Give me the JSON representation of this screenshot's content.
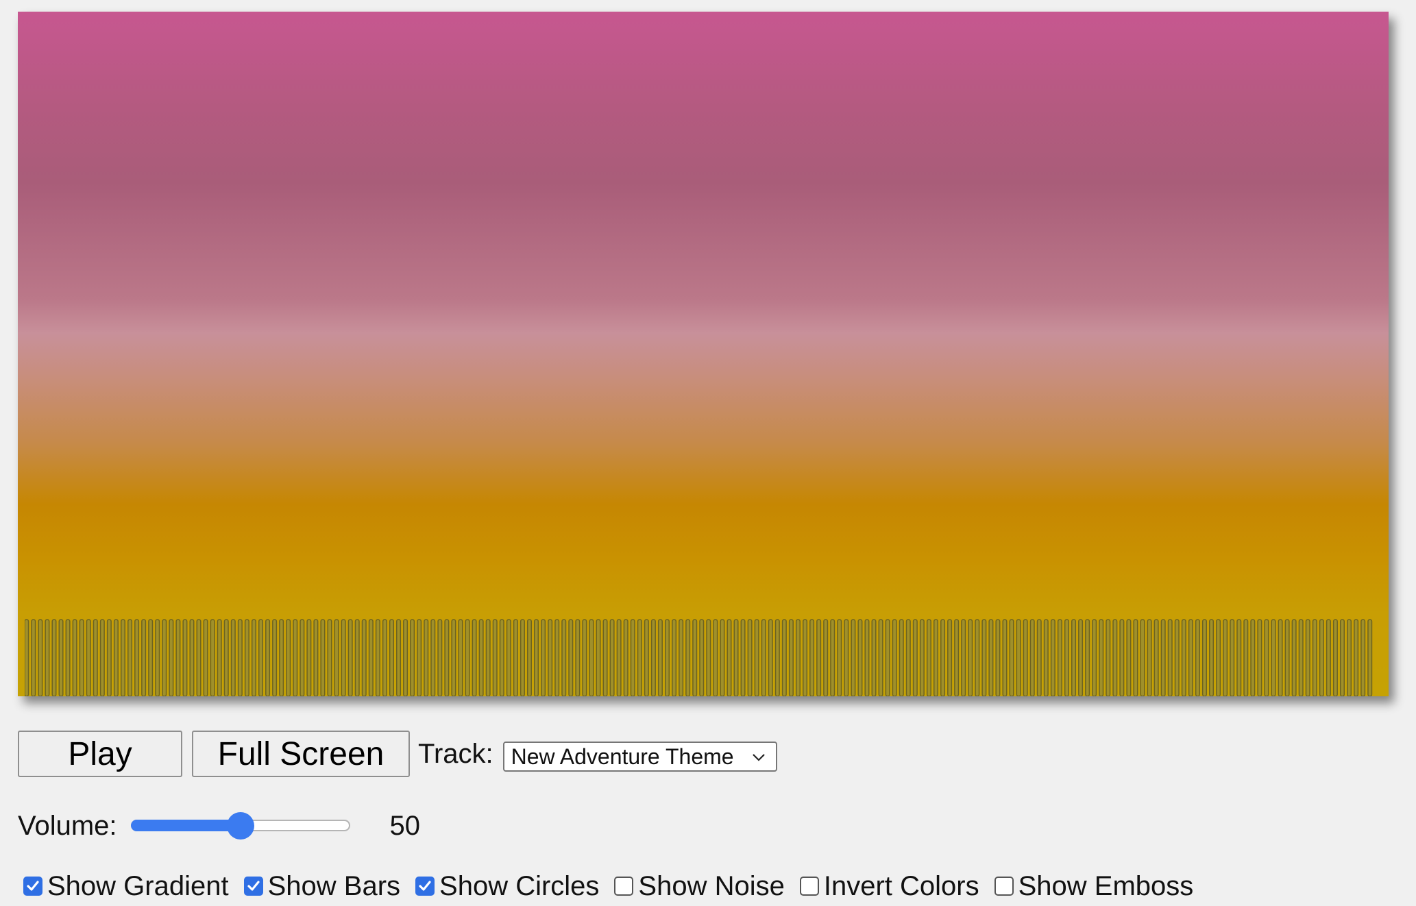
{
  "controls": {
    "play_label": "Play",
    "fullscreen_label": "Full Screen",
    "track_label": "Track:",
    "track_selected": "New Adventure Theme"
  },
  "volume": {
    "label": "Volume:",
    "value": 50,
    "max": 100,
    "value_text": "50"
  },
  "options": [
    {
      "label": "Show Gradient",
      "checked": true
    },
    {
      "label": "Show Bars",
      "checked": true
    },
    {
      "label": "Show Circles",
      "checked": true
    },
    {
      "label": "Show Noise",
      "checked": false
    },
    {
      "label": "Invert Colors",
      "checked": false
    },
    {
      "label": "Show Emboss",
      "checked": false
    }
  ],
  "colors": {
    "accent": "#3b7bf0",
    "bar_fill": "#a0902a",
    "bar_stroke": "#6d6320"
  }
}
